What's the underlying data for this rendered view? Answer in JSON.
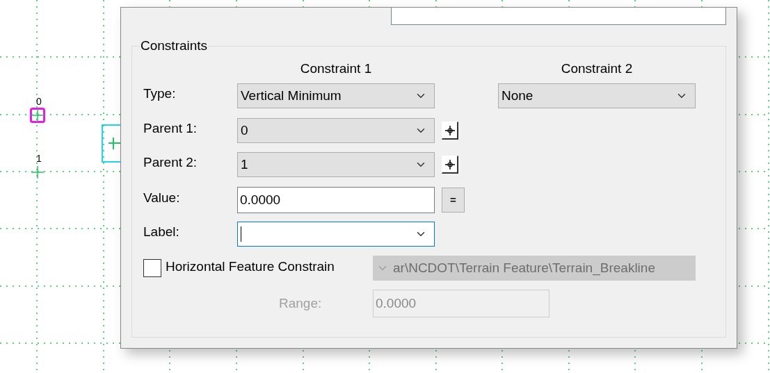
{
  "canvas": {
    "points": [
      {
        "label": "0",
        "selected": true
      },
      {
        "label": "1",
        "selected": false
      }
    ]
  },
  "constraints": {
    "title": "Constraints",
    "columns": [
      "Constraint 1",
      "Constraint 2"
    ],
    "type": {
      "label": "Type:",
      "constraint_1": "Vertical Minimum",
      "constraint_2": "None"
    },
    "parent_1": {
      "label": "Parent 1:",
      "value": "0"
    },
    "parent_2": {
      "label": "Parent 2:",
      "value": "1"
    },
    "value": {
      "label": "Value:",
      "value": "0.0000",
      "button": "="
    },
    "label": {
      "label": "Label:",
      "focused": true
    },
    "horizontal_feature": {
      "label": "Horizontal Feature Constrain",
      "checked": false,
      "feature": "ar\\NCDOT\\Terrain Feature\\Terrain_Breakline",
      "disabled": true
    },
    "range": {
      "label": "Range:",
      "value": "0.0000",
      "disabled": true
    }
  }
}
